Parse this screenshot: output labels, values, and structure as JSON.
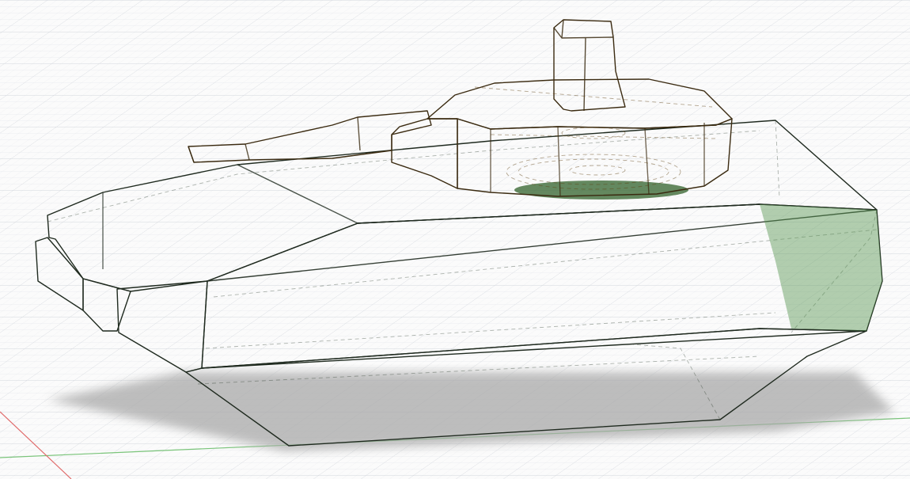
{
  "scene": {
    "view": "3d-cad-viewport",
    "background_color": "#fbfbfb",
    "grid_color": "#d9dde3",
    "axis_x_color": "#e06a6a",
    "axis_y_color": "#7ac47a",
    "model": {
      "hull": {
        "description": "tank-hull-body",
        "color": "#4f8f4a",
        "edge_color": "#1f2a1f"
      },
      "turret": {
        "description": "turret-with-barrel-and-cupola",
        "color": "#e0a243",
        "edge_color": "#3a2a10"
      },
      "shadow_color": "#a9a9a9"
    }
  }
}
